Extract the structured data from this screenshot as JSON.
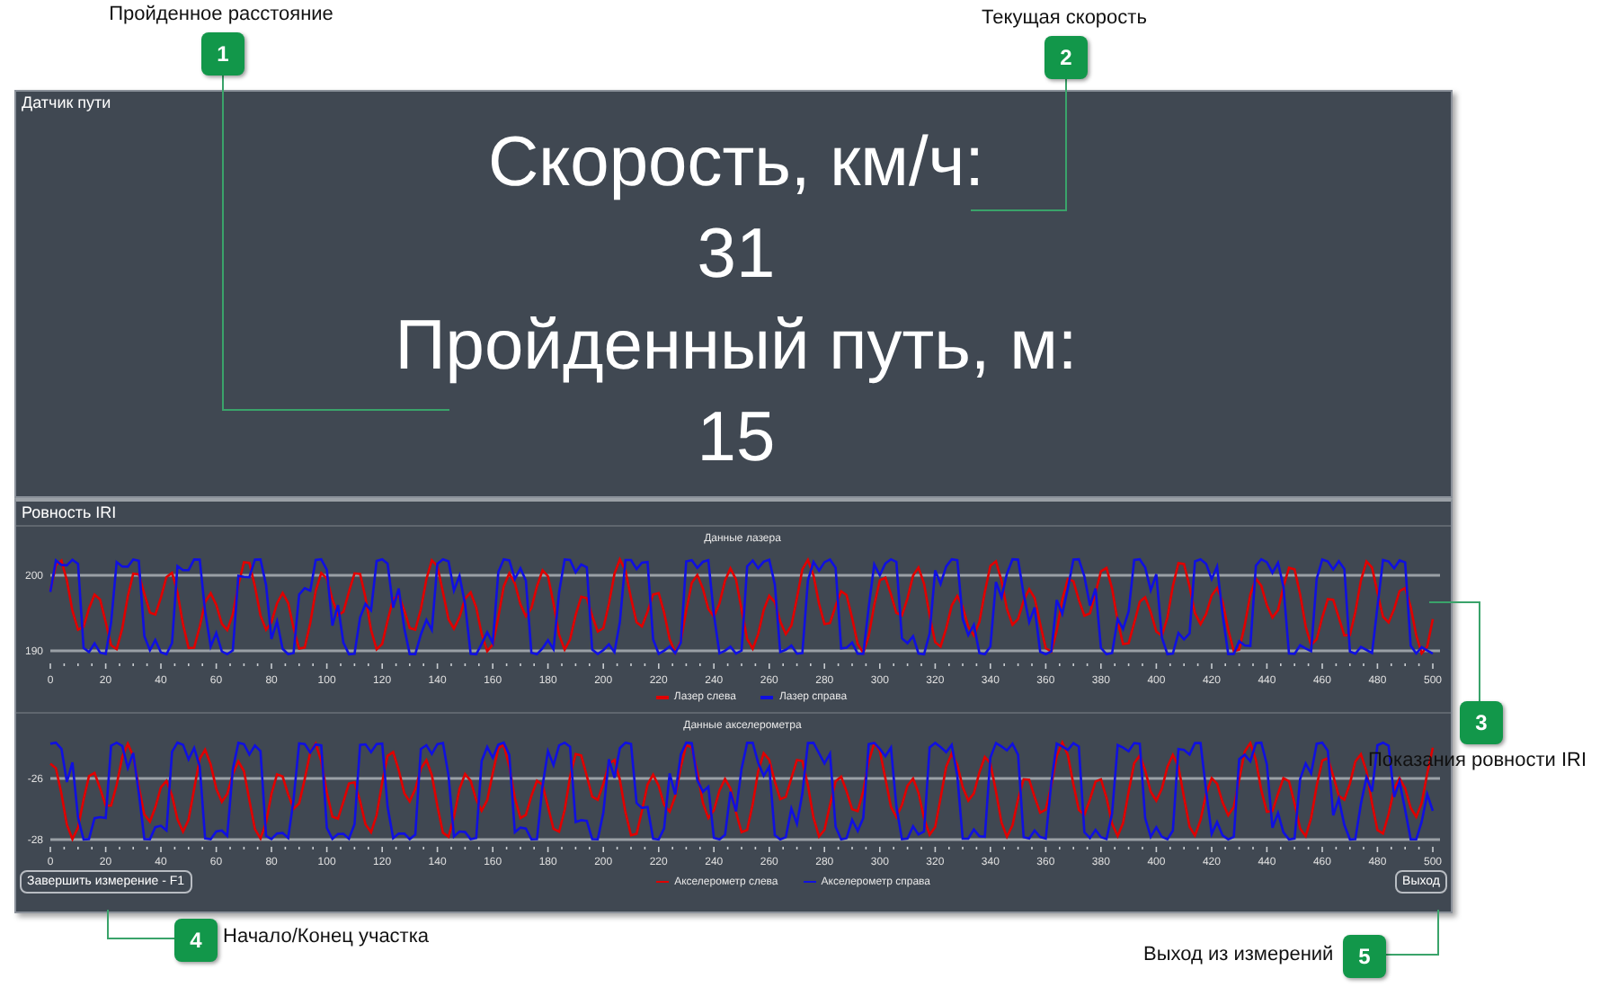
{
  "callouts": [
    {
      "number": "1",
      "label": "Пройденное расстояние"
    },
    {
      "number": "2",
      "label": "Текущая скорость"
    },
    {
      "number": "3",
      "label": "Показания ровности IRI"
    },
    {
      "number": "4",
      "label": "Начало/Конец участка"
    },
    {
      "number": "5",
      "label": "Выход из измерений"
    }
  ],
  "distance_panel": {
    "title": "Датчик пути",
    "lines": [
      "Скорость, км/ч:",
      "31",
      "Пройденный путь, м:",
      "15"
    ]
  },
  "iri_panel": {
    "title": "Ровность IRI",
    "charts": [
      {
        "title": "Данные лазера",
        "y_ticks": [
          "200",
          "190"
        ],
        "x_ticks": [
          "0",
          "20",
          "40",
          "60",
          "80",
          "100",
          "120",
          "140",
          "160",
          "180",
          "200",
          "220",
          "240",
          "260",
          "280",
          "300",
          "320",
          "340",
          "360",
          "380",
          "400",
          "420",
          "440",
          "460",
          "480",
          "500"
        ],
        "legend": [
          {
            "label": "Лазер слева",
            "color": "#e00000"
          },
          {
            "label": "Лазер справа",
            "color": "#1010e0"
          }
        ]
      },
      {
        "title": "Данные акселерометра",
        "y_ticks": [
          "-26",
          "-28"
        ],
        "x_ticks": [
          "0",
          "20",
          "40",
          "60",
          "80",
          "100",
          "120",
          "140",
          "160",
          "180",
          "200",
          "220",
          "240",
          "260",
          "280",
          "300",
          "320",
          "340",
          "360",
          "380",
          "400",
          "420",
          "440",
          "460",
          "480",
          "500"
        ],
        "legend": [
          {
            "label": "Акселерометр слева",
            "color": "#e00000"
          },
          {
            "label": "Акселерометр справа",
            "color": "#1010e0"
          }
        ]
      }
    ],
    "buttons": [
      "Завершить измерение - F1",
      "Выход"
    ]
  }
}
